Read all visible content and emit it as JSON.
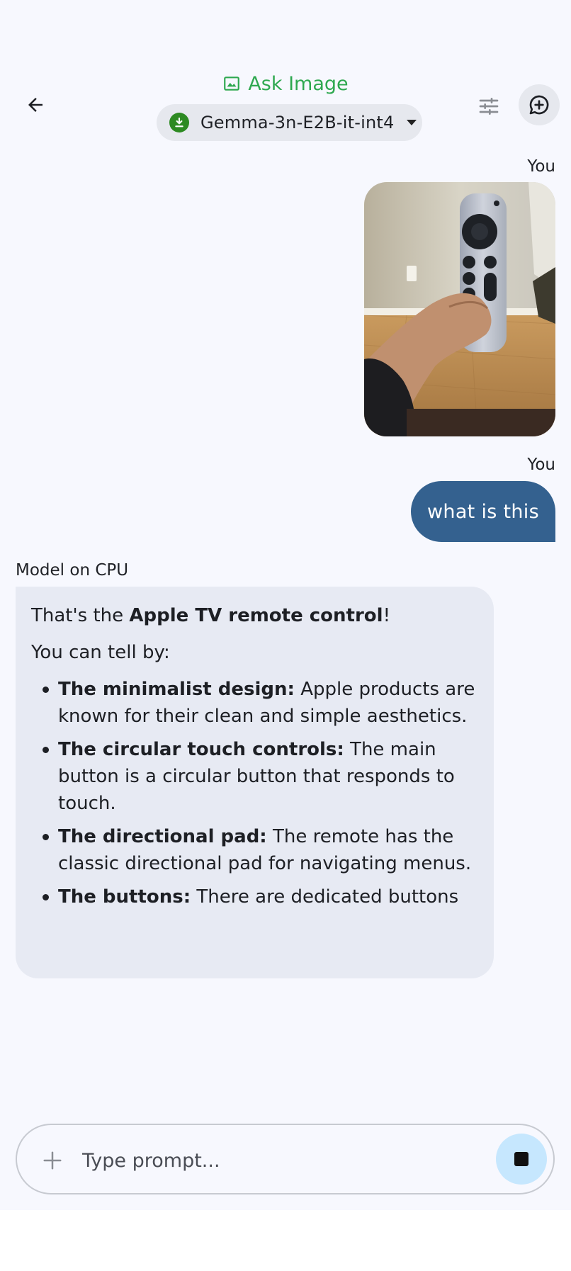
{
  "header": {
    "title": "Ask Image",
    "model_name": "Gemma-3n-E2B-it-int4",
    "accent_color": "#2ea84f",
    "icons": [
      "back-arrow-icon",
      "image-icon",
      "download-icon",
      "tune-icon",
      "new-chat-icon"
    ]
  },
  "chat": {
    "user_label_1": "You",
    "user_image_alt": "remote-control-photo",
    "user_label_2": "You",
    "user_message": "what is this",
    "user_bubble_color": "#34618f",
    "model_label": "Model on CPU",
    "model_response": {
      "intro_prefix": "That's the ",
      "intro_bold": "Apple TV remote control",
      "intro_suffix": "!",
      "lead": "You can tell by:",
      "points": [
        {
          "title": "The minimalist design:",
          "text": " Apple products are known for their clean and simple aesthetics."
        },
        {
          "title": "The circular touch controls:",
          "text": " The main button is a circular button that responds to touch."
        },
        {
          "title": "The directional pad:",
          "text": " The remote has the classic directional pad for navigating menus."
        },
        {
          "title": "The buttons:",
          "text": " There are dedicated buttons"
        }
      ]
    }
  },
  "input": {
    "placeholder": "Type prompt...",
    "stop_button_color": "#c6e7fe"
  }
}
